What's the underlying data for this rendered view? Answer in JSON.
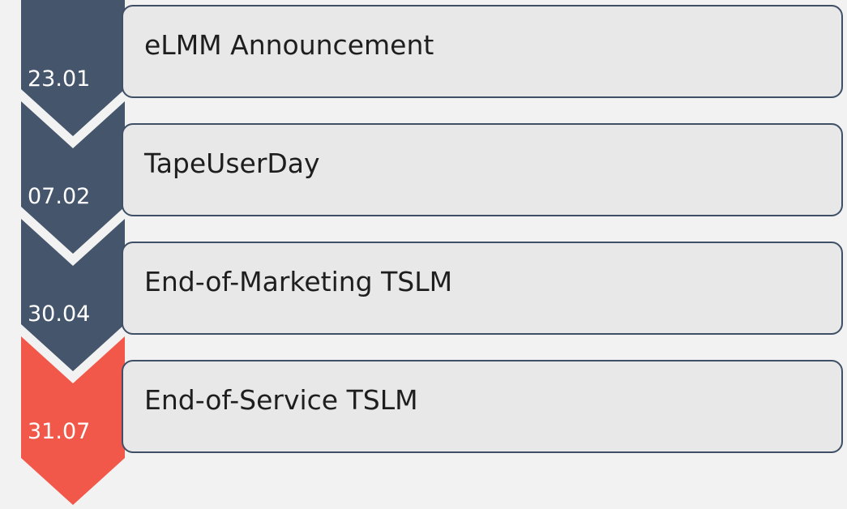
{
  "milestones": [
    {
      "date": "23.01",
      "label": "eLMM Announcement",
      "color": "#44556c"
    },
    {
      "date": "07.02",
      "label": "TapeUserDay",
      "color": "#44556c"
    },
    {
      "date": "30.04",
      "label": "End-of-Marketing TSLM",
      "color": "#44556c"
    },
    {
      "date": "31.07",
      "label": "End-of-Service TSLM",
      "color": "#f2584a"
    }
  ],
  "colors": {
    "background": "#f2f2f2",
    "box_fill": "#e8e8e8",
    "box_border": "#3e4f66"
  }
}
